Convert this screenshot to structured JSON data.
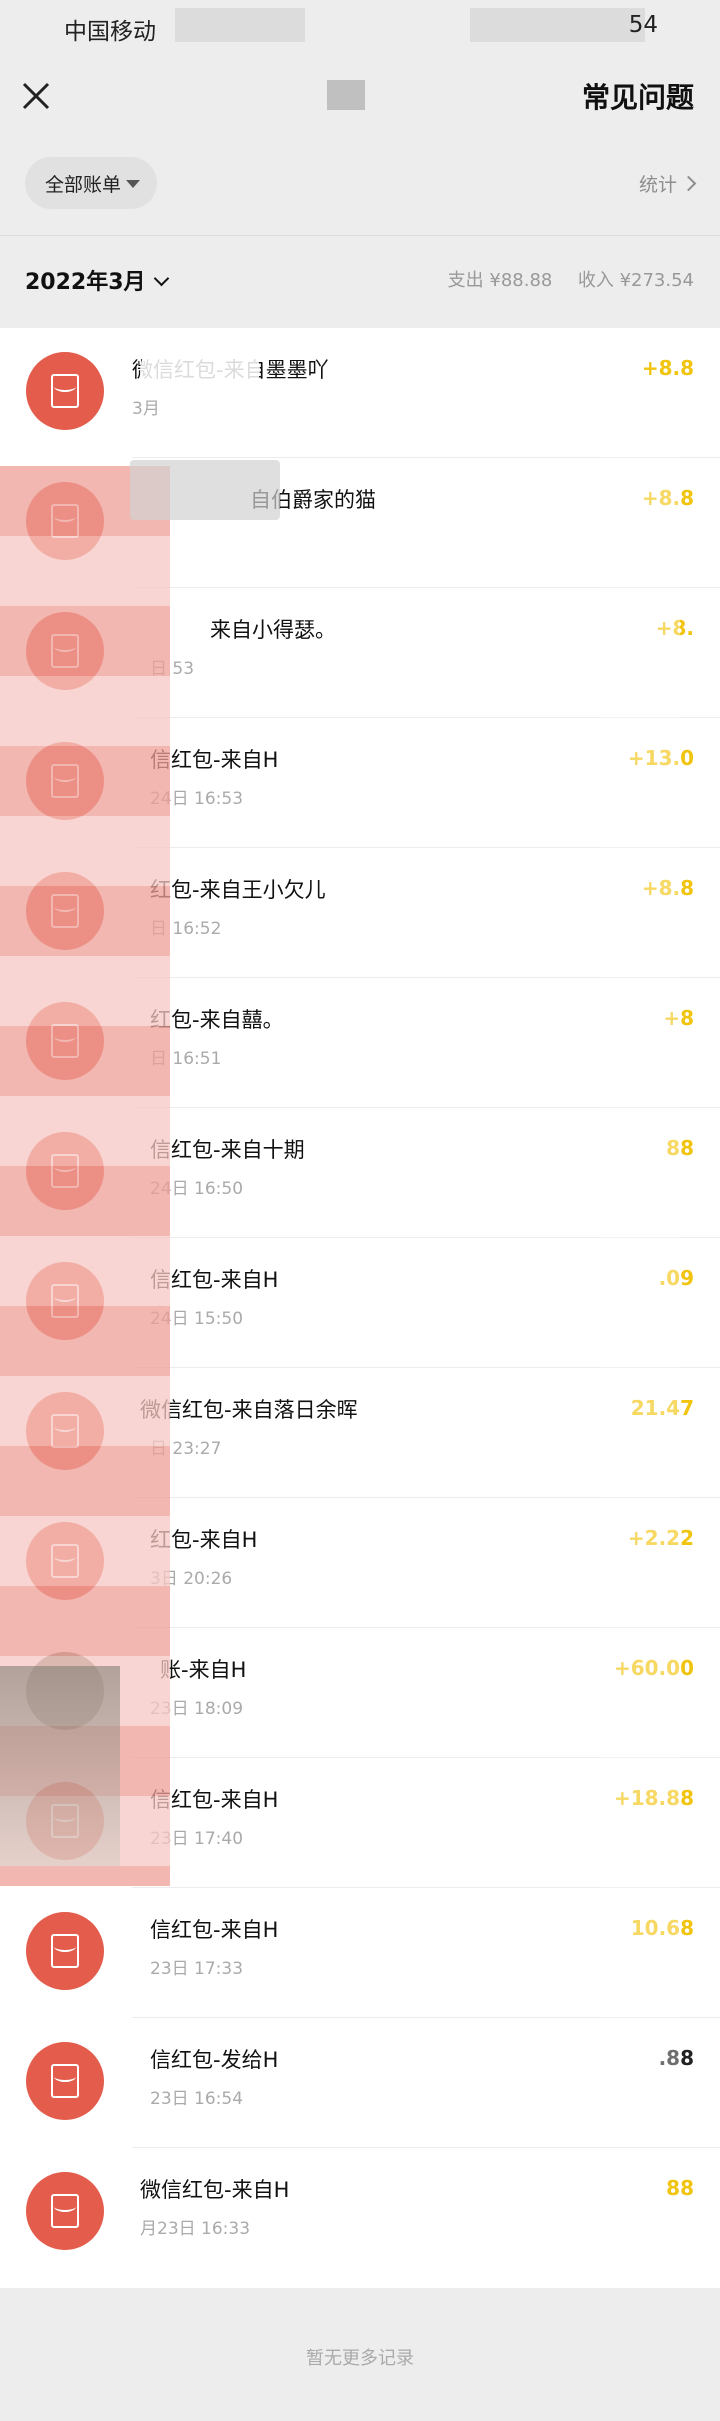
{
  "status": {
    "carrier": "中国移动",
    "time": "54"
  },
  "nav": {
    "title": "",
    "faq_label": "常见问题"
  },
  "filter": {
    "label": "全部账单",
    "stats_label": "统计"
  },
  "month": {
    "label": "2022年3月",
    "expense_label": "支出",
    "expense_value": "¥88.88",
    "income_label": "收入",
    "income_value": "¥273.54"
  },
  "transactions": [
    {
      "title": "微信红包-来自墨墨吖",
      "time": "3月",
      "amount": "+8.8"
    },
    {
      "title": "自伯爵家的猫",
      "time": "",
      "amount": "+8.8"
    },
    {
      "title": "来自小得瑟。",
      "time": "日 53",
      "amount": "+8."
    },
    {
      "title": "信红包-来自H",
      "time": "24日 16:53",
      "amount": "+13.0"
    },
    {
      "title": "红包-来自王小欠儿",
      "time": "日 16:52",
      "amount": "+8.8"
    },
    {
      "title": "红包-来自囍。",
      "time": "日 16:51",
      "amount": "+8"
    },
    {
      "title": "信红包-来自十期",
      "time": "24日 16:50",
      "amount": "88"
    },
    {
      "title": "信红包-来自H",
      "time": "24日 15:50",
      "amount": ".09"
    },
    {
      "title": "微信红包-来自落日余晖",
      "time": "日 23:27",
      "amount": "21.47"
    },
    {
      "title": "红包-来自H",
      "time": "3日 20:26",
      "amount": "+2.22"
    },
    {
      "title": "账-来自H",
      "time": "23日 18:09",
      "amount": "+60.00"
    },
    {
      "title": "信红包-来自H",
      "time": "23日 17:40",
      "amount": "+18.88"
    },
    {
      "title": "信红包-来自H",
      "time": "23日 17:33",
      "amount": "10.68"
    },
    {
      "title": "信红包-发给H",
      "time": "23日 16:54",
      "amount": ".88"
    },
    {
      "title": "微信红包-来自H",
      "time": "月23日 16:33",
      "amount": "88"
    }
  ],
  "footer": {
    "message": "暂无更多记录"
  },
  "colors": {
    "income_amount": "#f1c40f",
    "envelope_red": "#e35c4c",
    "background": "#ededed"
  }
}
